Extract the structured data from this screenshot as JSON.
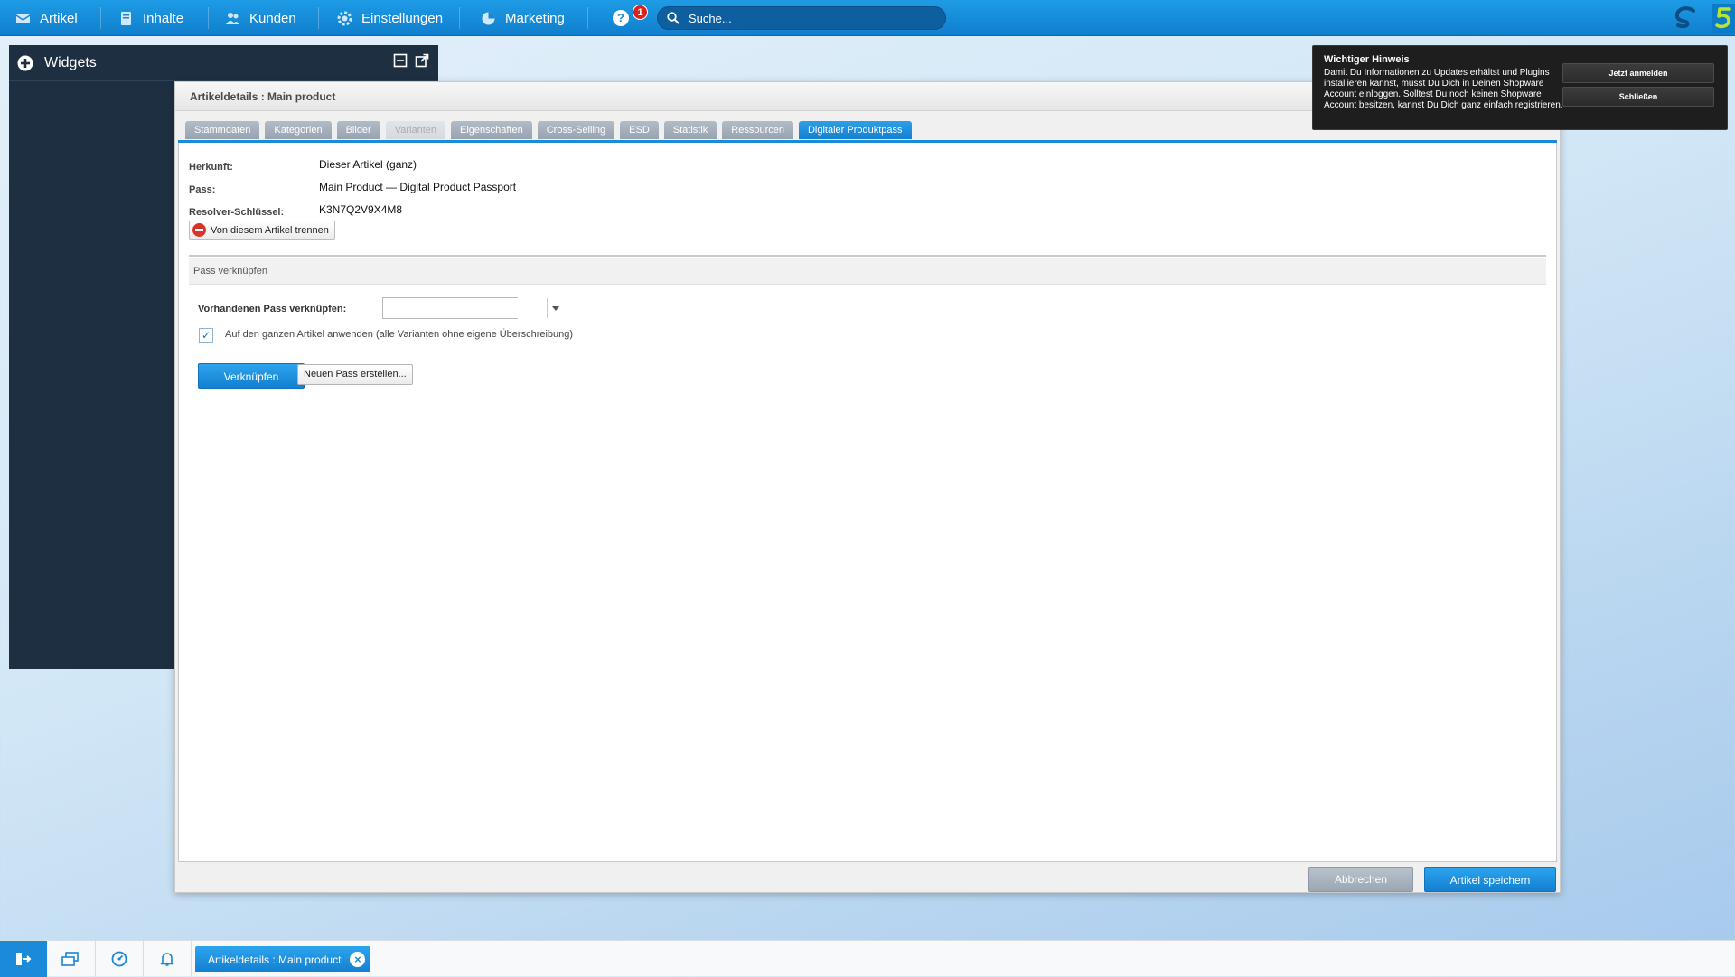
{
  "nav": {
    "items": [
      {
        "label": "Artikel",
        "icon": "article-icon"
      },
      {
        "label": "Inhalte",
        "icon": "content-icon"
      },
      {
        "label": "Kunden",
        "icon": "customers-icon"
      },
      {
        "label": "Einstellungen",
        "icon": "settings-icon"
      },
      {
        "label": "Marketing",
        "icon": "marketing-icon"
      }
    ],
    "help_icon": "?",
    "notification_count": "1",
    "search_placeholder": "Suche..."
  },
  "widgets": {
    "title": "Widgets"
  },
  "window": {
    "title": "Artikeldetails : Main product",
    "tabs": [
      {
        "label": "Stammdaten",
        "state": "normal"
      },
      {
        "label": "Kategorien",
        "state": "normal"
      },
      {
        "label": "Bilder",
        "state": "normal"
      },
      {
        "label": "Varianten",
        "state": "disabled"
      },
      {
        "label": "Eigenschaften",
        "state": "normal"
      },
      {
        "label": "Cross-Selling",
        "state": "normal"
      },
      {
        "label": "ESD",
        "state": "normal"
      },
      {
        "label": "Statistik",
        "state": "normal"
      },
      {
        "label": "Ressourcen",
        "state": "normal"
      },
      {
        "label": "Digitaler Produktpass",
        "state": "active"
      }
    ],
    "fields": {
      "origin_label": "Herkunft:",
      "origin_value": "Dieser Artikel (ganz)",
      "pass_label": "Pass:",
      "pass_value": "Main Product — Digital Product Passport",
      "resolver_label": "Resolver-Schlüssel:",
      "resolver_value": "K3N7Q2V9X4M8"
    },
    "unlink_button": "Von diesem Artikel trennen",
    "section_title": "Pass verknüpfen",
    "existing_pass_label": "Vorhandenen Pass verknüpfen:",
    "existing_pass_value": "",
    "apply_checkbox_label": "Auf den ganzen Artikel anwenden (alle Varianten ohne eigene Überschreibung)",
    "apply_checked": true,
    "link_button": "Verknüpfen",
    "new_pass_button": "Neuen Pass erstellen...",
    "cancel_button": "Abbrechen",
    "save_button": "Artikel speichern"
  },
  "notice": {
    "title": "Wichtiger Hinweis",
    "text": "Damit Du Informationen zu Updates erhältst und Plugins installieren kannst, musst Du Dich in Deinen Shopware Account einloggen. Solltest Du noch keinen Shopware Account besitzen, kannst Du Dich ganz einfach registrieren.",
    "login_button": "Jetzt anmelden",
    "close_button": "Schließen"
  },
  "taskbar": {
    "task_label": "Artikeldetails : Main product"
  },
  "colors": {
    "accent": "#1b8ad8",
    "nav_bg": "#1589d6",
    "widgets_bg": "#1e2f42",
    "notice_bg": "#1e1e1e"
  }
}
